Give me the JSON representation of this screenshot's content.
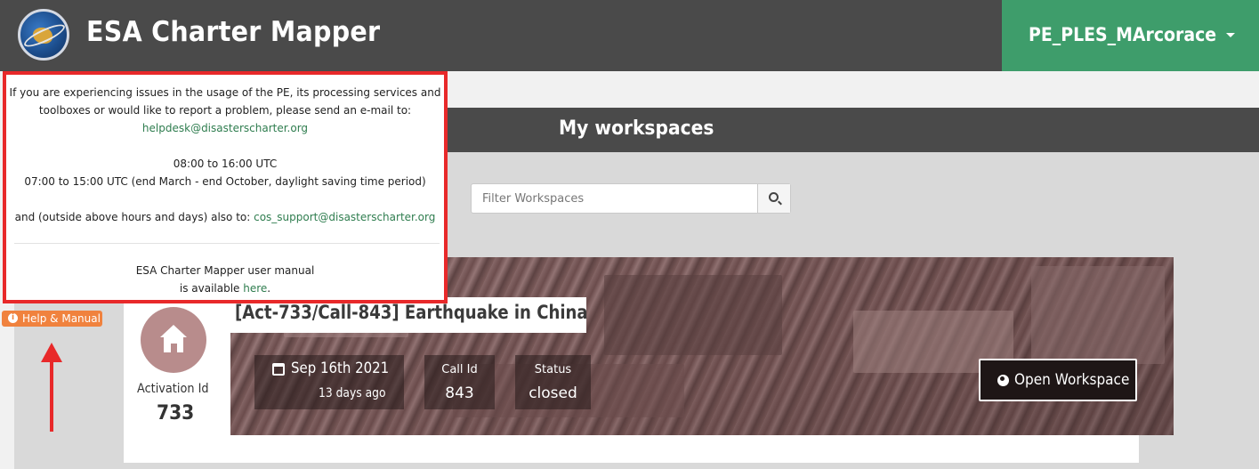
{
  "navbar": {
    "brand": "ESA Charter Mapper",
    "user_name": "PE_PLES_MArcorace"
  },
  "workspaces": {
    "title": "My workspaces",
    "filter_placeholder": "Filter Workspaces"
  },
  "workspace_card": {
    "title": "[Act-733/Call-843] Earthquake in China",
    "activation_label": "Activation Id",
    "activation_id": "733",
    "date": "Sep 16th 2021",
    "date_relative": "13 days ago",
    "call_id_label": "Call Id",
    "call_id": "843",
    "status_label": "Status",
    "status": "closed",
    "open_button": "Open Workspace"
  },
  "help_popup": {
    "line1": "If you are experiencing issues in the usage of the PE, its processing services and",
    "line2": "toolboxes or would like to report a problem, please send an e-mail to:",
    "helpdesk_email": "helpdesk@disasterscharter.org",
    "hours1": "08:00 to 16:00 UTC",
    "hours2": "07:00 to 15:00 UTC (end March - end October, daylight saving time period)",
    "outside_hours_text": "and (outside above hours and days) also to: ",
    "support_email": "cos_support@disasterscharter.org",
    "manual_line1": "ESA Charter Mapper user manual",
    "manual_line2_prefix": "is available ",
    "manual_link": "here",
    "manual_line2_suffix": "."
  },
  "help_tab": {
    "label": "Help & Manual"
  },
  "colors": {
    "navbar": "#4a4a4a",
    "user_menu": "#3e9d6b",
    "help_tab": "#f0823e",
    "highlight": "#e8292a",
    "link": "#2f7d4f"
  },
  "icons": [
    "esa-logo-icon",
    "caret-down-icon",
    "search-icon",
    "house-icon",
    "calendar-icon",
    "globe-icon",
    "info-icon",
    "arrow-up-icon"
  ]
}
